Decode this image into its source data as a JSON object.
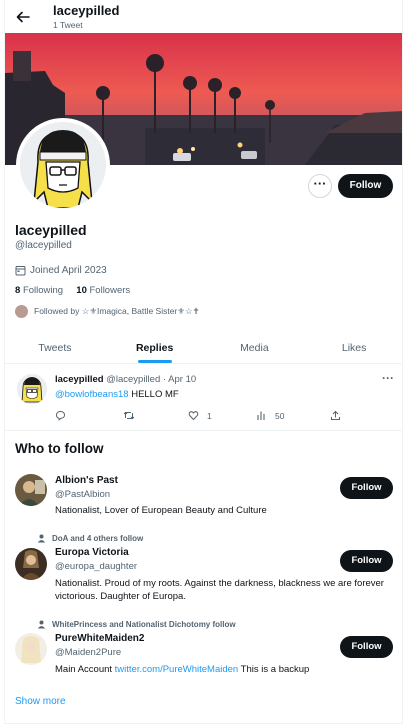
{
  "header": {
    "name": "laceypilled",
    "tweet_count": "1 Tweet"
  },
  "profile": {
    "more_label": "···",
    "follow_label": "Follow",
    "name": "laceypilled",
    "handle": "@laceypilled",
    "joined": "Joined April 2023",
    "following_count": "8",
    "following_label": "Following",
    "followers_count": "10",
    "followers_label": "Followers",
    "followed_by": "Followed by ☆⚜Imagica, Battle Sister⚜☆✝"
  },
  "tabs": [
    {
      "label": "Tweets",
      "active": false
    },
    {
      "label": "Replies",
      "active": true
    },
    {
      "label": "Media",
      "active": false
    },
    {
      "label": "Likes",
      "active": false
    }
  ],
  "tweet": {
    "name": "laceypilled",
    "meta": "@laceypilled · Apr 10",
    "more": "···",
    "mention": "@bowlofbeans18",
    "text": "HELLO MF",
    "reply_count": "",
    "retweet_count": "",
    "like_count": "1",
    "view_count": "50"
  },
  "who_to_follow": {
    "title": "Who to follow",
    "show_more": "Show more",
    "suggestions": [
      {
        "context": "",
        "name": "Albion's Past",
        "handle": "@PastAlbion",
        "bio": "Nationalist, Lover of European Beauty and Culture",
        "bio_link": "",
        "bio_after": "",
        "follow_label": "Follow"
      },
      {
        "context": "DoA and 4 others follow",
        "name": "Europa Victoria",
        "handle": "@europa_daughter",
        "bio": "Nationalist. Proud of my roots. Against the darkness, blackness we are forever victorious. Daughter of Europa.",
        "bio_link": "",
        "bio_after": "",
        "follow_label": "Follow"
      },
      {
        "context": "WhitePrincess and Nationalist Dichotomy follow",
        "name": "PureWhiteMaiden2",
        "handle": "@Maiden2Pure",
        "bio": "Main Account ",
        "bio_link": "twitter.com/PureWhiteMaiden",
        "bio_after": " This is a backup",
        "follow_label": "Follow"
      }
    ]
  },
  "colors": {
    "accent": "#1d9bf0",
    "text": "#0f1419",
    "muted": "#536471",
    "button": "#0f1419"
  }
}
